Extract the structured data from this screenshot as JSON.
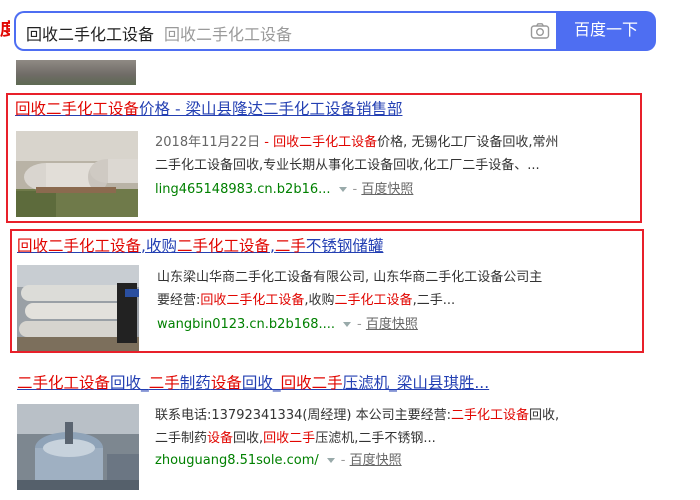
{
  "header": {
    "search_value": "回收二手化工设备",
    "search_ghost": "回收二手化工设备",
    "search_button": "百度一下",
    "camera_icon": "camera-icon"
  },
  "results": [
    {
      "title_hl": "回收二手化工设备",
      "title_rest": "价格 - 梁山县隆达二手化工设备销售部",
      "line1_date": "2018年11月22日",
      "line1_dash": " - ",
      "line1_hl": "回收二手化工设备",
      "line1_rest": "价格, 无锡化工厂设备回收,常州",
      "line2": "二手化工设备回收,专业长期从事化工设备回收,化工厂二手设备、...",
      "url": "ling465148983.cn.b2b16...",
      "sep": "-",
      "snapshot": "百度快照"
    },
    {
      "title_p1": "回收二手化工设备",
      "title_p2": ",收购",
      "title_p3": "二手化工设备",
      "title_p4": ",",
      "title_p5": "二手",
      "title_p6": "不锈钢储罐",
      "line1": "山东梁山华商二手化工设备有限公司, 山东华商二手化工设备公司主",
      "line2_pre": "要经营:",
      "line2_hl1": "回收二手化工设备",
      "line2_mid": ",收购",
      "line2_hl2": "二手化工设备",
      "line2_post": ",二手...",
      "url": "wangbin0123.cn.b2b168....",
      "sep": "-",
      "snapshot": "百度快照"
    },
    {
      "title_p1": "二手化工设备",
      "title_p2": "回收_",
      "title_p3": "二手",
      "title_p4": "制药",
      "title_p5": "设备",
      "title_p6": "回收_",
      "title_p7": "回收二手",
      "title_p8": "压滤机_梁山县琪胜...",
      "line1_pre": "联系电话:13792341334(周经理) 本公司主要经营:",
      "line1_hl": "二手化工设备",
      "line1_post": "回收,",
      "line2_pre": "二手制药",
      "line2_hl1": "设备",
      "line2_mid": "回收,",
      "line2_hl2": "回收二手",
      "line2_post": "压滤机,二手不锈钢...",
      "url": "zhouguang8.51sole.com/",
      "sep": "-",
      "snapshot": "百度快照"
    }
  ],
  "colors": {
    "brand_blue": "#4e6ef2",
    "link_blue": "#2440b3",
    "highlight_red": "#e10601",
    "url_green": "#008000",
    "frame_red": "#e8202a"
  }
}
